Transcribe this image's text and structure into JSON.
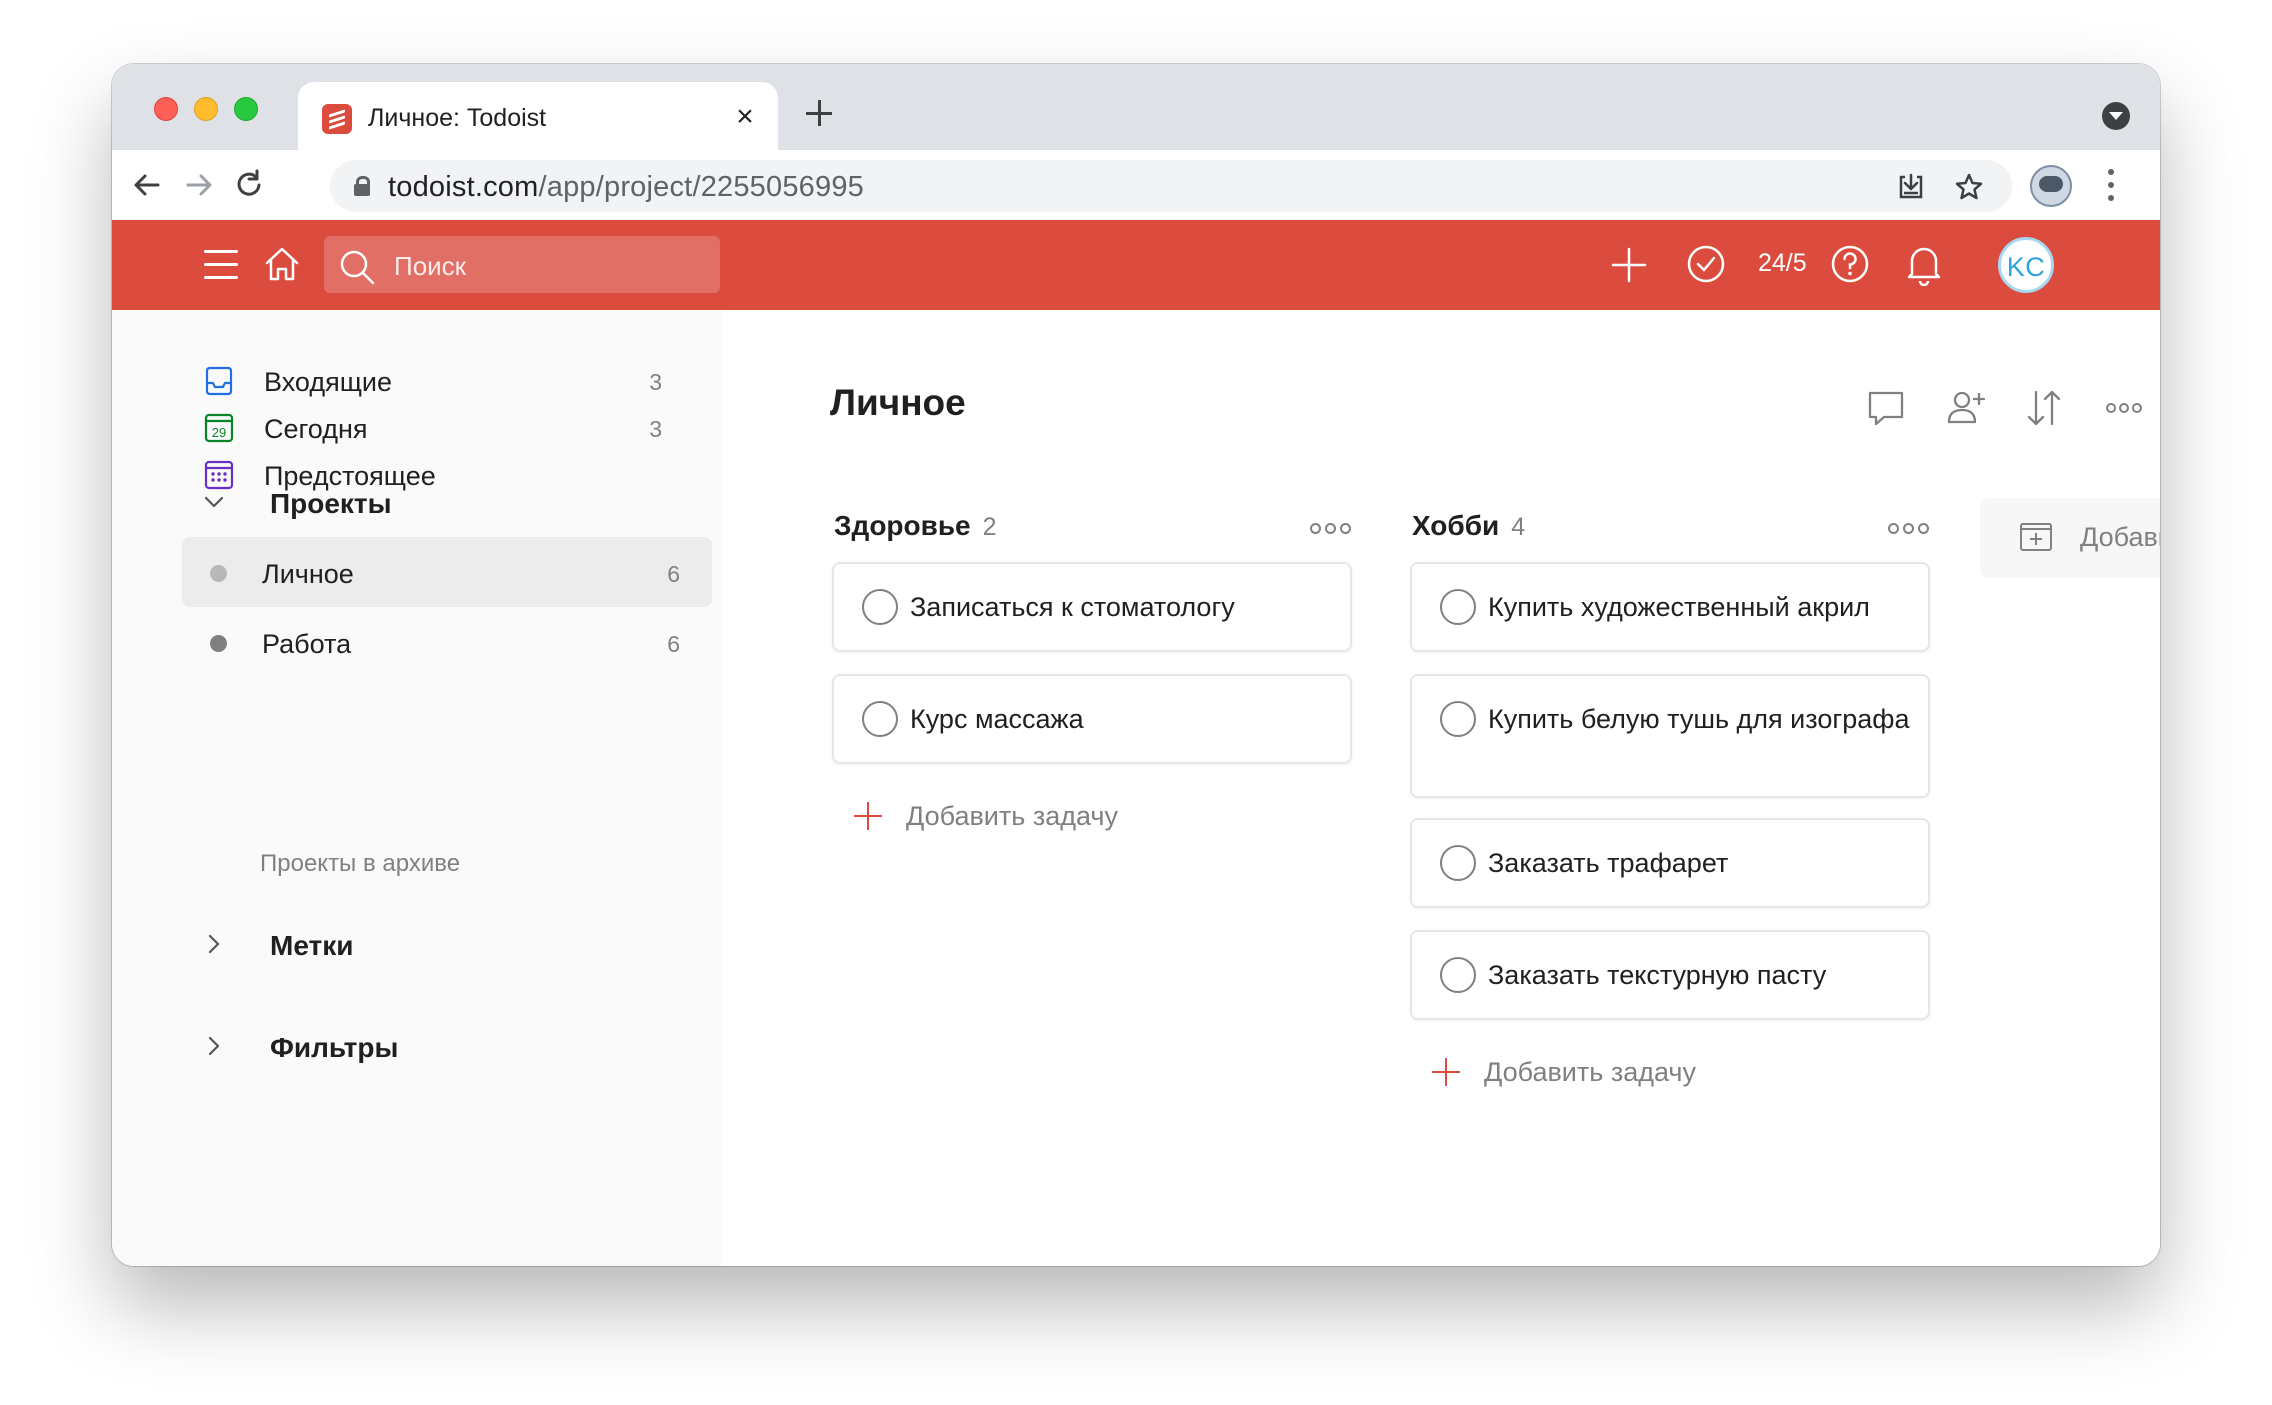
{
  "browser": {
    "tab_title": "Личное: Todoist",
    "tab_close": "×",
    "url_domain": "todoist.com",
    "url_path": "/app/project/2255056995"
  },
  "app_header": {
    "search_placeholder": "Поиск",
    "karma": "24/5",
    "avatar_initials": "KC",
    "brand_color": "#db4c3f"
  },
  "sidebar": {
    "nav": [
      {
        "label": "Входящие",
        "count": "3",
        "icon": "inbox-icon"
      },
      {
        "label": "Сегодня",
        "count": "3",
        "icon": "calendar-today-icon",
        "day": "29"
      },
      {
        "label": "Предстоящее",
        "count": "",
        "icon": "calendar-upcoming-icon"
      }
    ],
    "projects_title": "Проекты",
    "projects": [
      {
        "label": "Личное",
        "count": "6",
        "color": "#b8b8b8",
        "active": true
      },
      {
        "label": "Работа",
        "count": "6",
        "color": "#808080",
        "active": false
      }
    ],
    "archive": "Проекты в архиве",
    "labels_title": "Метки",
    "filters_title": "Фильтры"
  },
  "main": {
    "title": "Личное",
    "sections": [
      {
        "name": "Здоровье",
        "count": "2",
        "tasks": [
          "Записаться к стоматологу",
          "Курс массажа"
        ],
        "add_task": "Добавить задачу"
      },
      {
        "name": "Хобби",
        "count": "4",
        "tasks": [
          "Купить художественный акрил",
          "Купить белую тушь для изографа",
          "Заказать трафарет",
          "Заказать текстурную пасту"
        ],
        "add_task": "Добавить задачу"
      }
    ],
    "add_section": "Добавить раздел"
  }
}
